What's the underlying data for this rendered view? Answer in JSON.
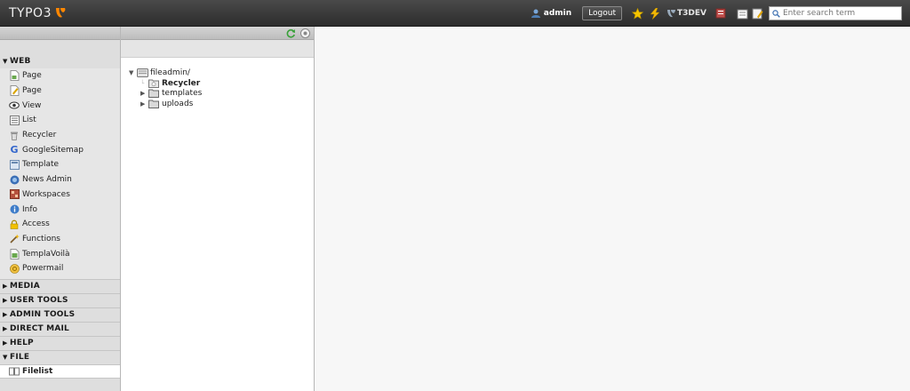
{
  "topbar": {
    "logo": "TYPO3",
    "username": "admin",
    "logout_label": "Logout",
    "t3dev_label": "T3DEV",
    "search_placeholder": "Enter search term",
    "accent": "#ff8700"
  },
  "module_menu": {
    "web": {
      "label": "WEB",
      "items": [
        {
          "label": "Page",
          "icon": "page-icon"
        },
        {
          "label": "Page",
          "icon": "page-edit-icon"
        },
        {
          "label": "View",
          "icon": "eye-icon"
        },
        {
          "label": "List",
          "icon": "list-icon"
        },
        {
          "label": "Recycler",
          "icon": "trash-icon"
        },
        {
          "label": "GoogleSitemap",
          "icon": "google-icon"
        },
        {
          "label": "Template",
          "icon": "template-icon"
        },
        {
          "label": "News Admin",
          "icon": "news-icon"
        },
        {
          "label": "Workspaces",
          "icon": "workspaces-icon"
        },
        {
          "label": "Info",
          "icon": "info-icon"
        },
        {
          "label": "Access",
          "icon": "lock-icon"
        },
        {
          "label": "Functions",
          "icon": "wand-icon"
        },
        {
          "label": "TemplaVoilà",
          "icon": "templavoila-icon"
        },
        {
          "label": "Powermail",
          "icon": "powermail-icon"
        }
      ]
    },
    "collapsed_groups": [
      "MEDIA",
      "USER TOOLS",
      "ADMIN TOOLS",
      "DIRECT MAIL",
      "HELP"
    ],
    "file": {
      "label": "FILE",
      "items": [
        {
          "label": "Filelist",
          "icon": "filelist-icon"
        }
      ]
    }
  },
  "tree": {
    "root": "fileadmin/",
    "children": [
      {
        "label": "Recycler"
      },
      {
        "label": "templates"
      },
      {
        "label": "uploads"
      }
    ]
  }
}
